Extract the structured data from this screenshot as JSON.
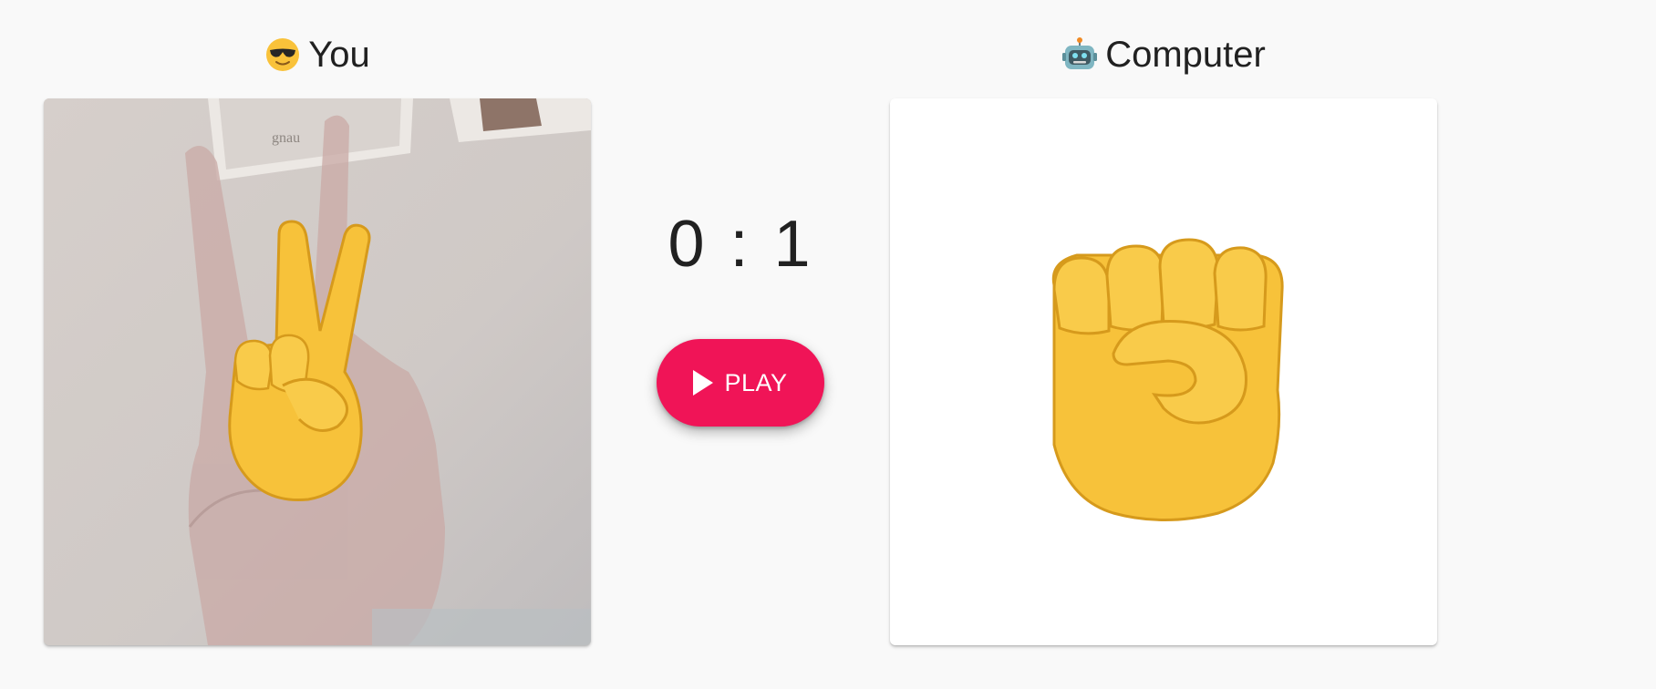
{
  "you": {
    "label": "You",
    "icon": "sunglasses-face-icon",
    "gesture": "scissors",
    "gesture_icon": "victory-hand-icon"
  },
  "computer": {
    "label": "Computer",
    "icon": "robot-face-icon",
    "gesture": "rock",
    "gesture_icon": "raised-fist-icon"
  },
  "score": {
    "text": "0 : 1",
    "you": 0,
    "computer": 1
  },
  "play_button": {
    "label": "PLAY",
    "icon": "play-icon"
  },
  "colors": {
    "background": "#f9f9f9",
    "accent": "#f01457",
    "emoji_yellow": "#f7c23a",
    "text": "#212121"
  }
}
